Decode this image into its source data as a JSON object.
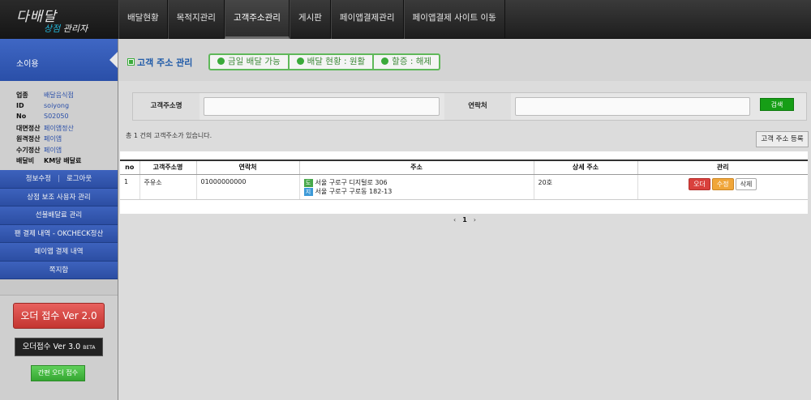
{
  "logo": {
    "main": "다배달",
    "sub_accent": "상점",
    "sub_rest": " 관리자"
  },
  "nav": [
    "배달현황",
    "목적지관리",
    "고객주소관리",
    "게시판",
    "페이앱결제관리",
    "페이앱결제 사이트 이동"
  ],
  "nav_active": 2,
  "sidebar": {
    "store_name": "소이용",
    "info": [
      {
        "key": "업종",
        "value": "배달음식점"
      },
      {
        "key": "ID",
        "value": "soiyong"
      },
      {
        "key": "No",
        "value": "S02050"
      },
      {
        "key": "대면정산",
        "value": "페이앱정산"
      },
      {
        "key": "원격정산",
        "value": "페이앱"
      },
      {
        "key": "수기정산",
        "value": "페이앱"
      },
      {
        "key": "배달비",
        "value": "KM당 배달료"
      }
    ],
    "account_edit": "정보수정",
    "logout": "로그아웃",
    "menu": [
      "상점 보조 사용자 관리",
      "선불배달료 관리",
      "팬 결제 내역 - OKCHECK정산",
      "페이앱 결제 내역",
      "쪽지함"
    ],
    "order_btn": "오더 접수 Ver 2.0",
    "order3_btn": "오더접수 Ver 3.0",
    "order3_beta": "BETA",
    "simple_btn": "간편 오더 접수"
  },
  "main": {
    "title": "고객 주소 관리",
    "status": [
      "금일 배달 가능",
      "배달 현황 : 원활",
      "할증 : 해제"
    ],
    "search": {
      "name_label": "고객주소명",
      "phone_label": "연락처",
      "button": "검색"
    },
    "count_text": "총 1 건의 고객주소가 있습니다.",
    "register_btn": "고객 주소 등록",
    "table": {
      "headers": [
        "no",
        "고객주소명",
        "연락처",
        "주소",
        "상세 주소",
        "관리"
      ],
      "rows": [
        {
          "no": "1",
          "name": "주유소",
          "phone": "01000000000",
          "road_tag": "도",
          "road": "서울 구로구 디지털로 306",
          "jibun_tag": "지",
          "jibun": "서울 구로구 구로동 182-13",
          "detail": "20호",
          "btn_order": "오더",
          "btn_edit": "수정",
          "btn_delete": "삭제"
        }
      ]
    },
    "pager": {
      "prev": "‹",
      "current": "1",
      "next": "›"
    }
  }
}
